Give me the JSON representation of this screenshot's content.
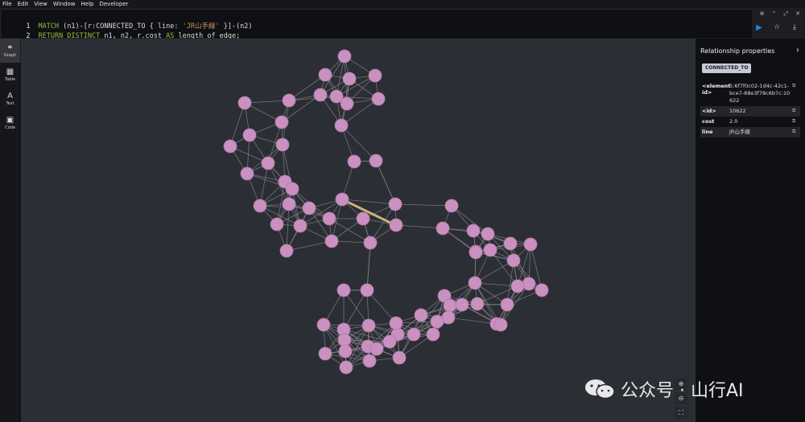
{
  "menu": [
    "File",
    "Edit",
    "View",
    "Window",
    "Help",
    "Developer"
  ],
  "editor": {
    "lines": [
      {
        "num": "1",
        "a": "MATCH",
        "b": " (n1)-[r:CONNECTED_TO { line: ",
        "c": "'JR山手線'",
        "d": " }]-(n2)"
      },
      {
        "num": "2",
        "a": "RETURN DISTINCT",
        "b": " n1, n2, r.cost ",
        "c": "AS",
        "d": " length_of_edge;"
      }
    ]
  },
  "rail": [
    {
      "label": "Graph",
      "icon": "graph-icon"
    },
    {
      "label": "Table",
      "icon": "table-icon"
    },
    {
      "label": "Text",
      "icon": "text-icon"
    },
    {
      "label": "Code",
      "icon": "code-icon"
    }
  ],
  "panel": {
    "title": "Relationship properties",
    "badge": "CONNECTED_TO",
    "props": [
      {
        "key": "<element id>",
        "value": "5:6f7f0c02-1d4c-42c1-bce7-88e3f78c6b7c:10622"
      },
      {
        "key": "<id>",
        "value": "10622"
      },
      {
        "key": "cost",
        "value": "2.0"
      },
      {
        "key": "line",
        "value": "JR山手線"
      }
    ]
  },
  "watermark": {
    "text": "公众号 · 山行AI"
  },
  "colors": {
    "node": "#c990c0",
    "edge": "#8a8b8f",
    "highlight": "#c9b27a",
    "run": "#1c84e0"
  }
}
